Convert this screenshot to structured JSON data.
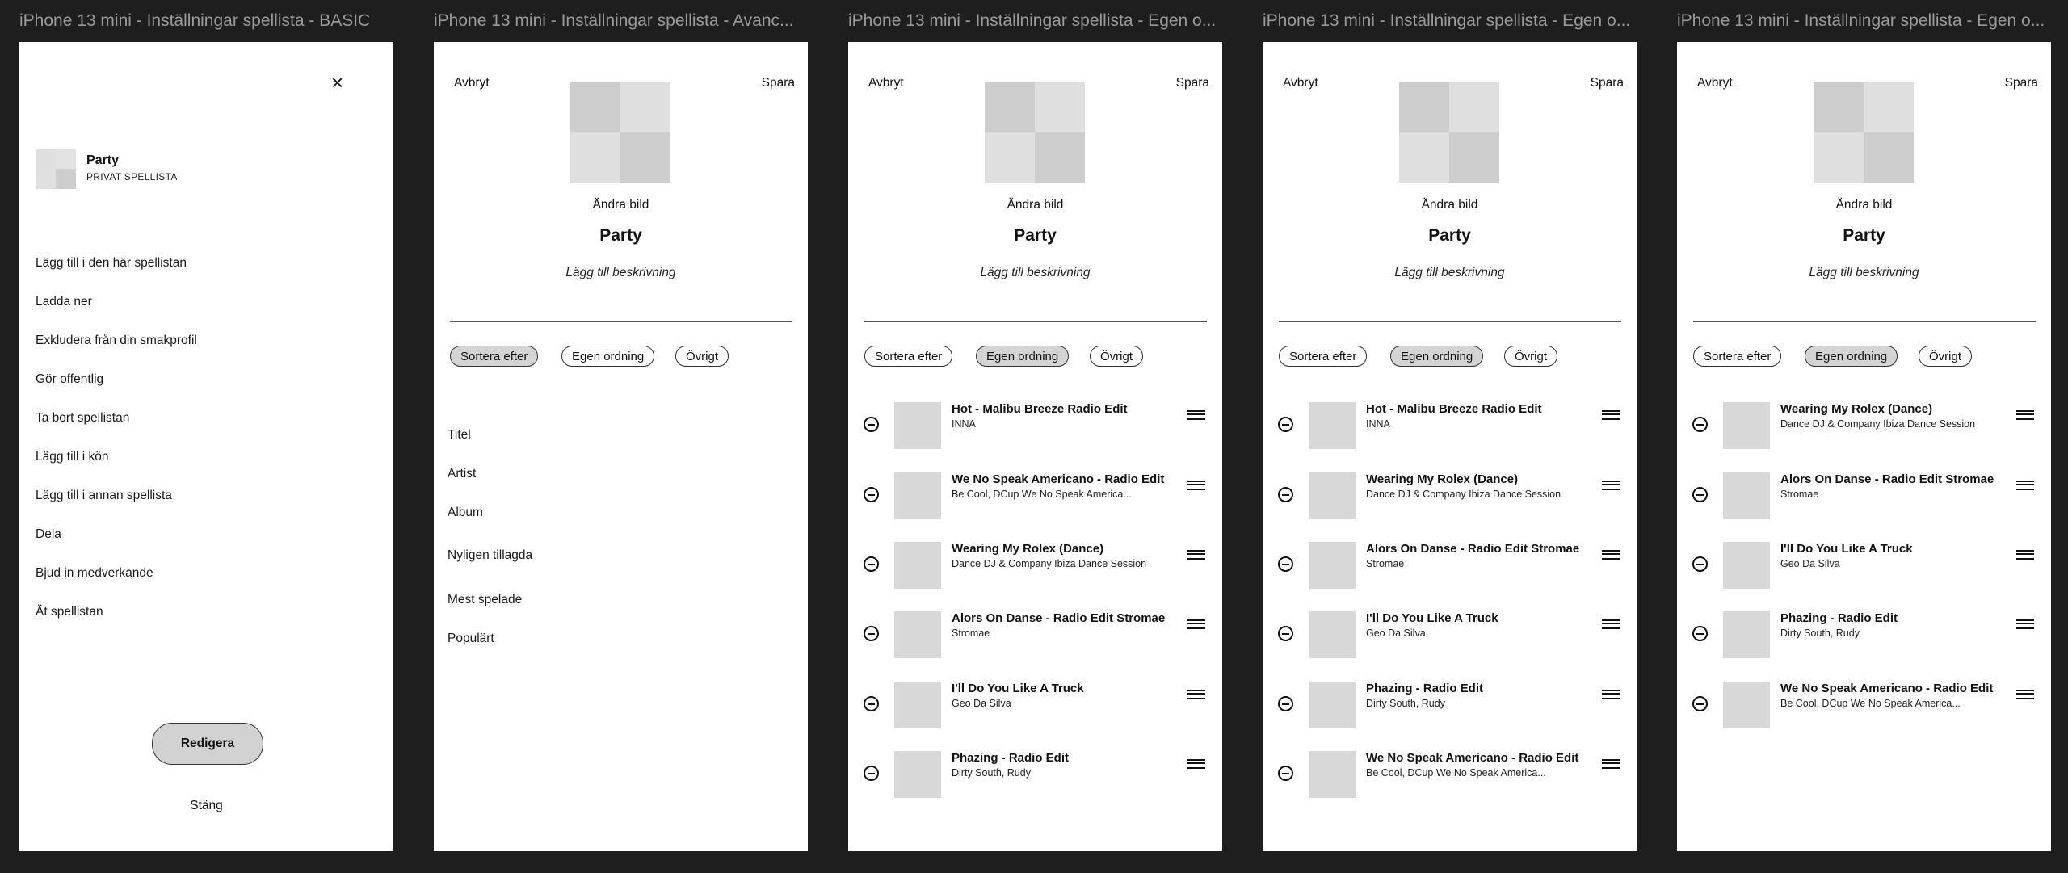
{
  "frames": {
    "basic": {
      "title": "iPhone 13 mini - Inställningar spellista - BASIC",
      "close_icon": "×",
      "playlist_name": "Party",
      "playlist_type": "PRIVAT SPELLISTA",
      "menu": [
        "Lägg till i den här spellistan",
        "Ladda ner",
        "Exkludera från din smakprofil",
        "Gör offentlig",
        "Ta bort spellistan",
        "Lägg till i kön",
        "Lägg till i annan spellista",
        "Dela",
        "Bjud in medverkande",
        "Ät spellistan"
      ],
      "edit_button": "Redigera",
      "close_link": "Stäng"
    },
    "advanced": {
      "title": "iPhone 13 mini - Inställningar spellista - Avanc...",
      "cancel": "Avbryt",
      "save": "Spara",
      "change_image": "Ändra bild",
      "playlist_title": "Party",
      "description_placeholder": "Lägg till beskrivning",
      "chips": [
        "Sortera efter",
        "Egen ordning",
        "Övrigt"
      ],
      "active_chip": "Sortera efter",
      "sort_options": [
        "Titel",
        "Artist",
        "Album",
        "Nyligen tillagda",
        "Mest spelade",
        "Populärt"
      ]
    },
    "custom1": {
      "title": "iPhone 13 mini - Inställningar spellista - Egen o...",
      "cancel": "Avbryt",
      "save": "Spara",
      "change_image": "Ändra bild",
      "playlist_title": "Party",
      "description_placeholder": "Lägg till beskrivning",
      "chips": [
        "Sortera efter",
        "Egen ordning",
        "Övrigt"
      ],
      "active_chip": "Egen ordning",
      "tracks": [
        {
          "title": "Hot - Malibu Breeze Radio Edit",
          "artist": "INNA"
        },
        {
          "title": "We No Speak Americano - Radio Edit",
          "artist": "Be Cool, DCup  We No Speak America..."
        },
        {
          "title": "Wearing My Rolex (Dance)",
          "artist": "Dance DJ & Company Ibiza Dance Session"
        },
        {
          "title": "Alors On Danse - Radio Edit Stromae",
          "artist": "Stromae"
        },
        {
          "title": "I'll Do You Like A Truck",
          "artist": "Geo Da Silva"
        },
        {
          "title": "Phazing - Radio Edit",
          "artist": "Dirty South, Rudy"
        }
      ]
    },
    "custom2": {
      "title": "iPhone 13 mini - Inställningar spellista - Egen o...",
      "cancel": "Avbryt",
      "save": "Spara",
      "change_image": "Ändra bild",
      "playlist_title": "Party",
      "description_placeholder": "Lägg till beskrivning",
      "chips": [
        "Sortera efter",
        "Egen ordning",
        "Övrigt"
      ],
      "active_chip": "Egen ordning",
      "tracks": [
        {
          "title": "Hot - Malibu Breeze Radio Edit",
          "artist": "INNA"
        },
        {
          "title": "Wearing My Rolex (Dance)",
          "artist": "Dance DJ & Company Ibiza Dance Session"
        },
        {
          "title": "Alors On Danse - Radio Edit Stromae",
          "artist": "Stromae"
        },
        {
          "title": "I'll Do You Like A Truck",
          "artist": "Geo Da Silva"
        },
        {
          "title": "Phazing - Radio Edit",
          "artist": "Dirty South, Rudy"
        },
        {
          "title": "We No Speak Americano - Radio Edit",
          "artist": "Be Cool, DCup  We No Speak America..."
        }
      ]
    },
    "custom3": {
      "title": "iPhone 13 mini - Inställningar spellista - Egen o...",
      "cancel": "Avbryt",
      "save": "Spara",
      "change_image": "Ändra bild",
      "playlist_title": "Party",
      "description_placeholder": "Lägg till beskrivning",
      "chips": [
        "Sortera efter",
        "Egen ordning",
        "Övrigt"
      ],
      "active_chip": "Egen ordning",
      "tracks": [
        {
          "title": "Wearing My Rolex (Dance)",
          "artist": "Dance DJ & Company Ibiza Dance Session"
        },
        {
          "title": "Alors On Danse - Radio Edit Stromae",
          "artist": "Stromae"
        },
        {
          "title": "I'll Do You Like A Truck",
          "artist": "Geo Da Silva"
        },
        {
          "title": "Phazing - Radio Edit",
          "artist": "Dirty South, Rudy"
        },
        {
          "title": "We No Speak Americano - Radio Edit",
          "artist": "Be Cool, DCup  We No Speak America..."
        }
      ]
    }
  },
  "icons": {
    "close": "close-icon",
    "remove": "remove-circle-icon",
    "drag": "drag-handle-icon"
  }
}
